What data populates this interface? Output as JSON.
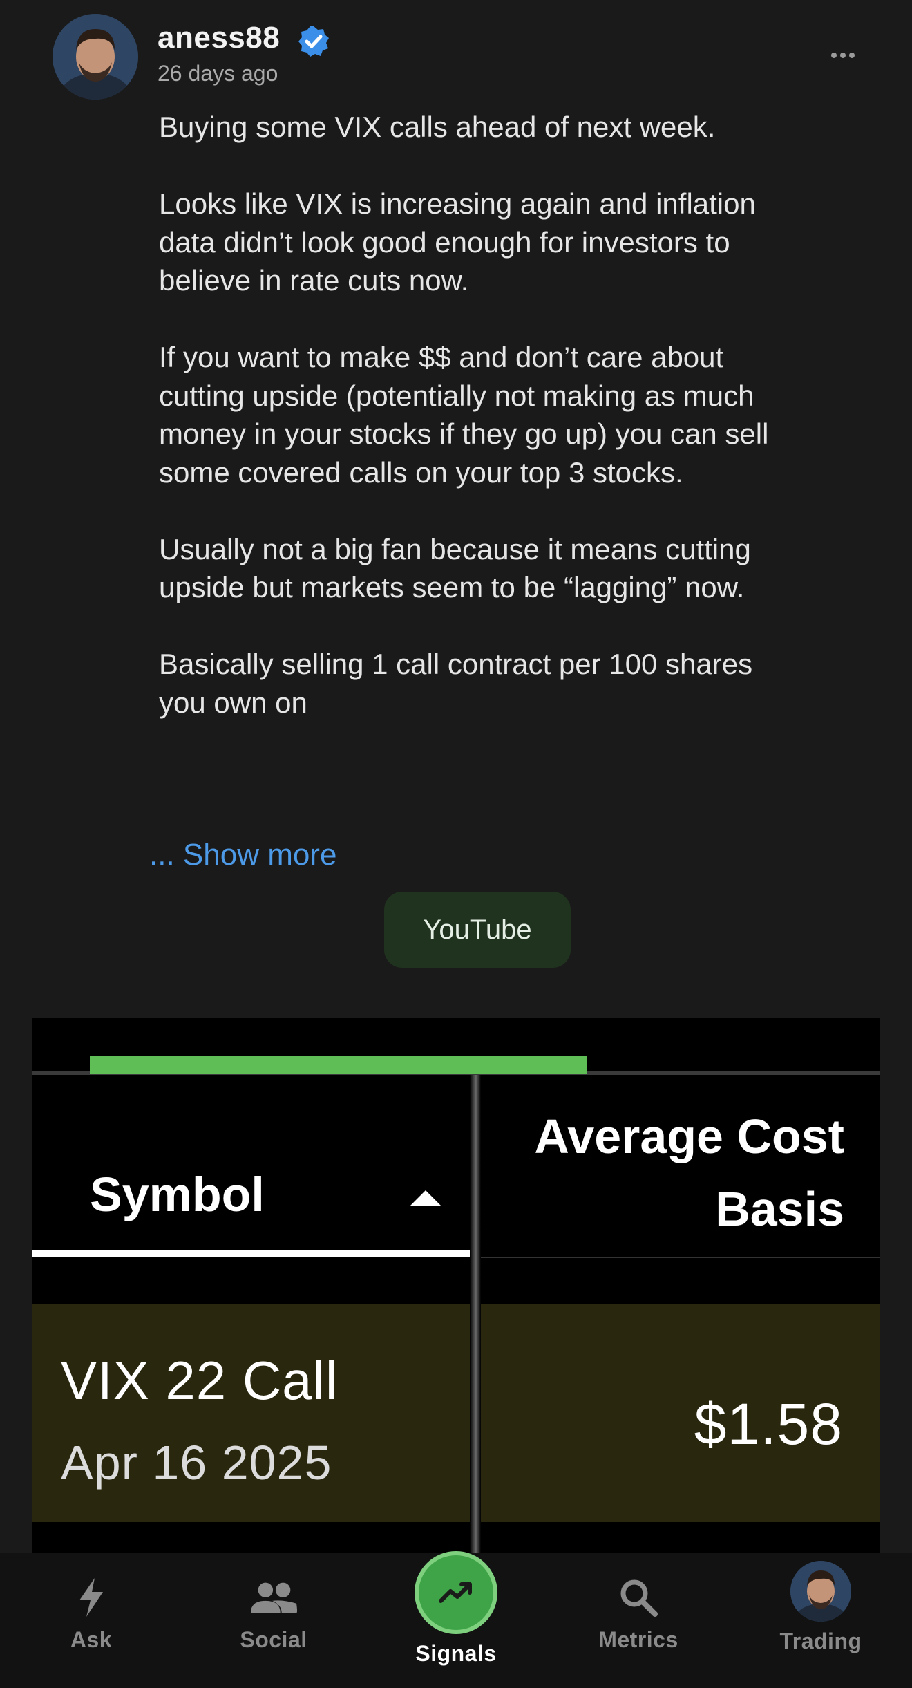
{
  "post": {
    "username": "aness88",
    "timestamp": "26 days ago",
    "paragraphs": [
      "Buying some VIX calls ahead of next week.",
      "Looks like VIX is increasing again and inflation data didn’t look good enough for investors to believe in rate cuts now.",
      "If you want to make $$ and don’t care about cutting upside (potentially not making as much money in your stocks if they go up) you can sell some covered calls on your top 3 stocks.",
      "Usually not a big fan because it means cutting upside but markets seem to be “lagging” now.",
      "Basically selling 1 call contract per 100 shares you own on"
    ],
    "show_more": "... Show more",
    "tag_button": "YouTube"
  },
  "embed": {
    "col_symbol": "Symbol",
    "col_avg_line1": "Average Cost",
    "col_avg_line2": "Basis",
    "row": {
      "name": "VIX 22 Call",
      "date": "Apr 16 2025",
      "price": "$1.58"
    }
  },
  "nav": {
    "ask": "Ask",
    "social": "Social",
    "signals": "Signals",
    "metrics": "Metrics",
    "trading": "Trading",
    "active": "signals"
  },
  "colors": {
    "background": "#1a1a1a",
    "link": "#4d9be8",
    "accent_green": "#3fa447",
    "verified_blue": "#3b8fe8"
  },
  "icons": {
    "verified": "verified-badge-icon",
    "more": "more-dots-icon",
    "ask": "lightning-icon",
    "social": "people-icon",
    "signals": "trend-line-icon",
    "metrics": "search-icon"
  }
}
